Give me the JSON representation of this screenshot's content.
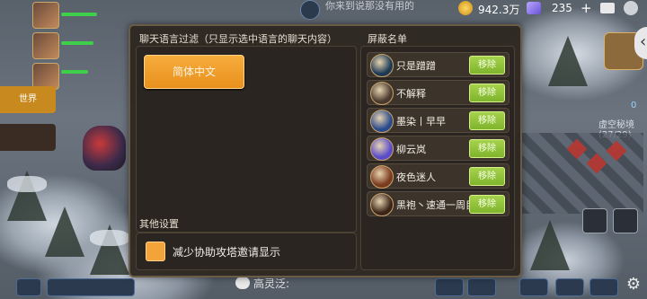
{
  "topbar": {
    "chat_preview": "你来到说那没有用的",
    "gold": "942.3万",
    "diamonds": "235",
    "plus": "+"
  },
  "left": {
    "orange_tab": "世界"
  },
  "right": {
    "count": "0",
    "area_name": "虚空秘境 (27/29)"
  },
  "dialog": {
    "lang_section_title": "聊天语言过滤（只显示选中语言的聊天内容）",
    "lang_button": "简体中文",
    "other_section_title": "其他设置",
    "reduce_invites_label": "减少协助攻塔邀请显示",
    "block_title": "屏蔽名单",
    "remove_label": "移除",
    "blocked": [
      {
        "name": "只是蹭蹭",
        "avatar_color": "#1d3a55"
      },
      {
        "name": "不解释",
        "avatar_color": "#4a3a2e"
      },
      {
        "name": "墨染丨早早",
        "avatar_color": "#2a4a8c"
      },
      {
        "name": "柳云岚",
        "avatar_color": "#5a4cc8"
      },
      {
        "name": "夜色迷人",
        "avatar_color": "#7a3a1e"
      },
      {
        "name": "黑袍丶速通一周目",
        "avatar_color": "#3a2418"
      }
    ]
  },
  "bottom": {
    "chat_name": "高灵泛:"
  }
}
